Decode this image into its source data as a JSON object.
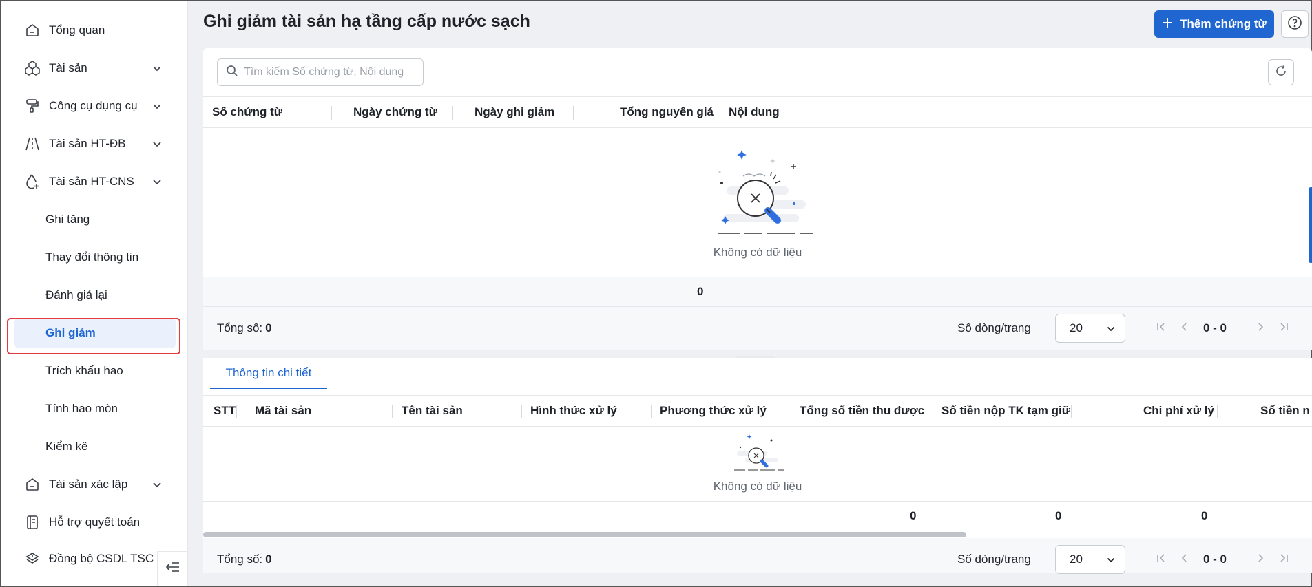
{
  "sidebar": {
    "items": [
      {
        "label": "Tổng quan",
        "icon": "home-icon",
        "has_chevron": false
      },
      {
        "label": "Tài sản",
        "icon": "boxes-icon",
        "has_chevron": true
      },
      {
        "label": "Công cụ dụng cụ",
        "icon": "paint-roller-icon",
        "has_chevron": true
      },
      {
        "label": "Tài sản HT-ĐB",
        "icon": "road-icon",
        "has_chevron": true
      },
      {
        "label": "Tài sản HT-CNS",
        "icon": "water-drop-icon",
        "has_chevron": true
      }
    ],
    "sub_items": [
      {
        "label": "Ghi tăng"
      },
      {
        "label": "Thay đổi thông tin"
      },
      {
        "label": "Đánh giá lại"
      },
      {
        "label": "Ghi giảm",
        "active": true
      },
      {
        "label": "Trích khấu hao"
      },
      {
        "label": "Tính hao mòn"
      },
      {
        "label": "Kiểm kê"
      }
    ],
    "items_after": [
      {
        "label": "Tài sản xác lập",
        "icon": "home-icon",
        "has_chevron": true
      },
      {
        "label": "Hỗ trợ quyết toán",
        "icon": "book-icon",
        "has_chevron": false
      },
      {
        "label": "Đồng bộ CSDL TSC",
        "icon": "layers-sync-icon",
        "has_chevron": false
      }
    ]
  },
  "header": {
    "title": "Ghi giảm tài sản hạ tầng cấp nước sạch",
    "add_label": "Thêm chứng từ"
  },
  "search": {
    "placeholder": "Tìm kiếm Số chứng từ, Nội dung"
  },
  "top_table": {
    "columns": [
      "Số chứng từ",
      "Ngày chứng từ",
      "Ngày ghi giảm",
      "Tổng nguyên giá",
      "Nội dung"
    ],
    "empty_text": "Không có dữ liệu",
    "summary": {
      "total_cost": "0"
    },
    "pager": {
      "total_label": "Tổng số:",
      "total_value": "0",
      "rows_label": "Số dòng/trang",
      "rows_value": "20",
      "range": "0 - 0"
    }
  },
  "detail": {
    "tab_label": "Thông tin chi tiết",
    "columns": [
      "STT",
      "Mã tài sản",
      "Tên tài sản",
      "Hình thức xử lý",
      "Phương thức xử lý",
      "Tổng số tiền thu được",
      "Số tiền nộp TK tạm giữ",
      "Chi phí xử lý",
      "Số tiền n"
    ],
    "empty_text": "Không có dữ liệu",
    "summary": {
      "total_received": "0",
      "deposit": "0",
      "cost": "0"
    },
    "pager": {
      "total_label": "Tổng số:",
      "total_value": "0",
      "rows_label": "Số dòng/trang",
      "rows_value": "20",
      "range": "0 - 0"
    }
  },
  "colors": {
    "accent": "#1f66d1",
    "highlight": "#e5393b"
  }
}
